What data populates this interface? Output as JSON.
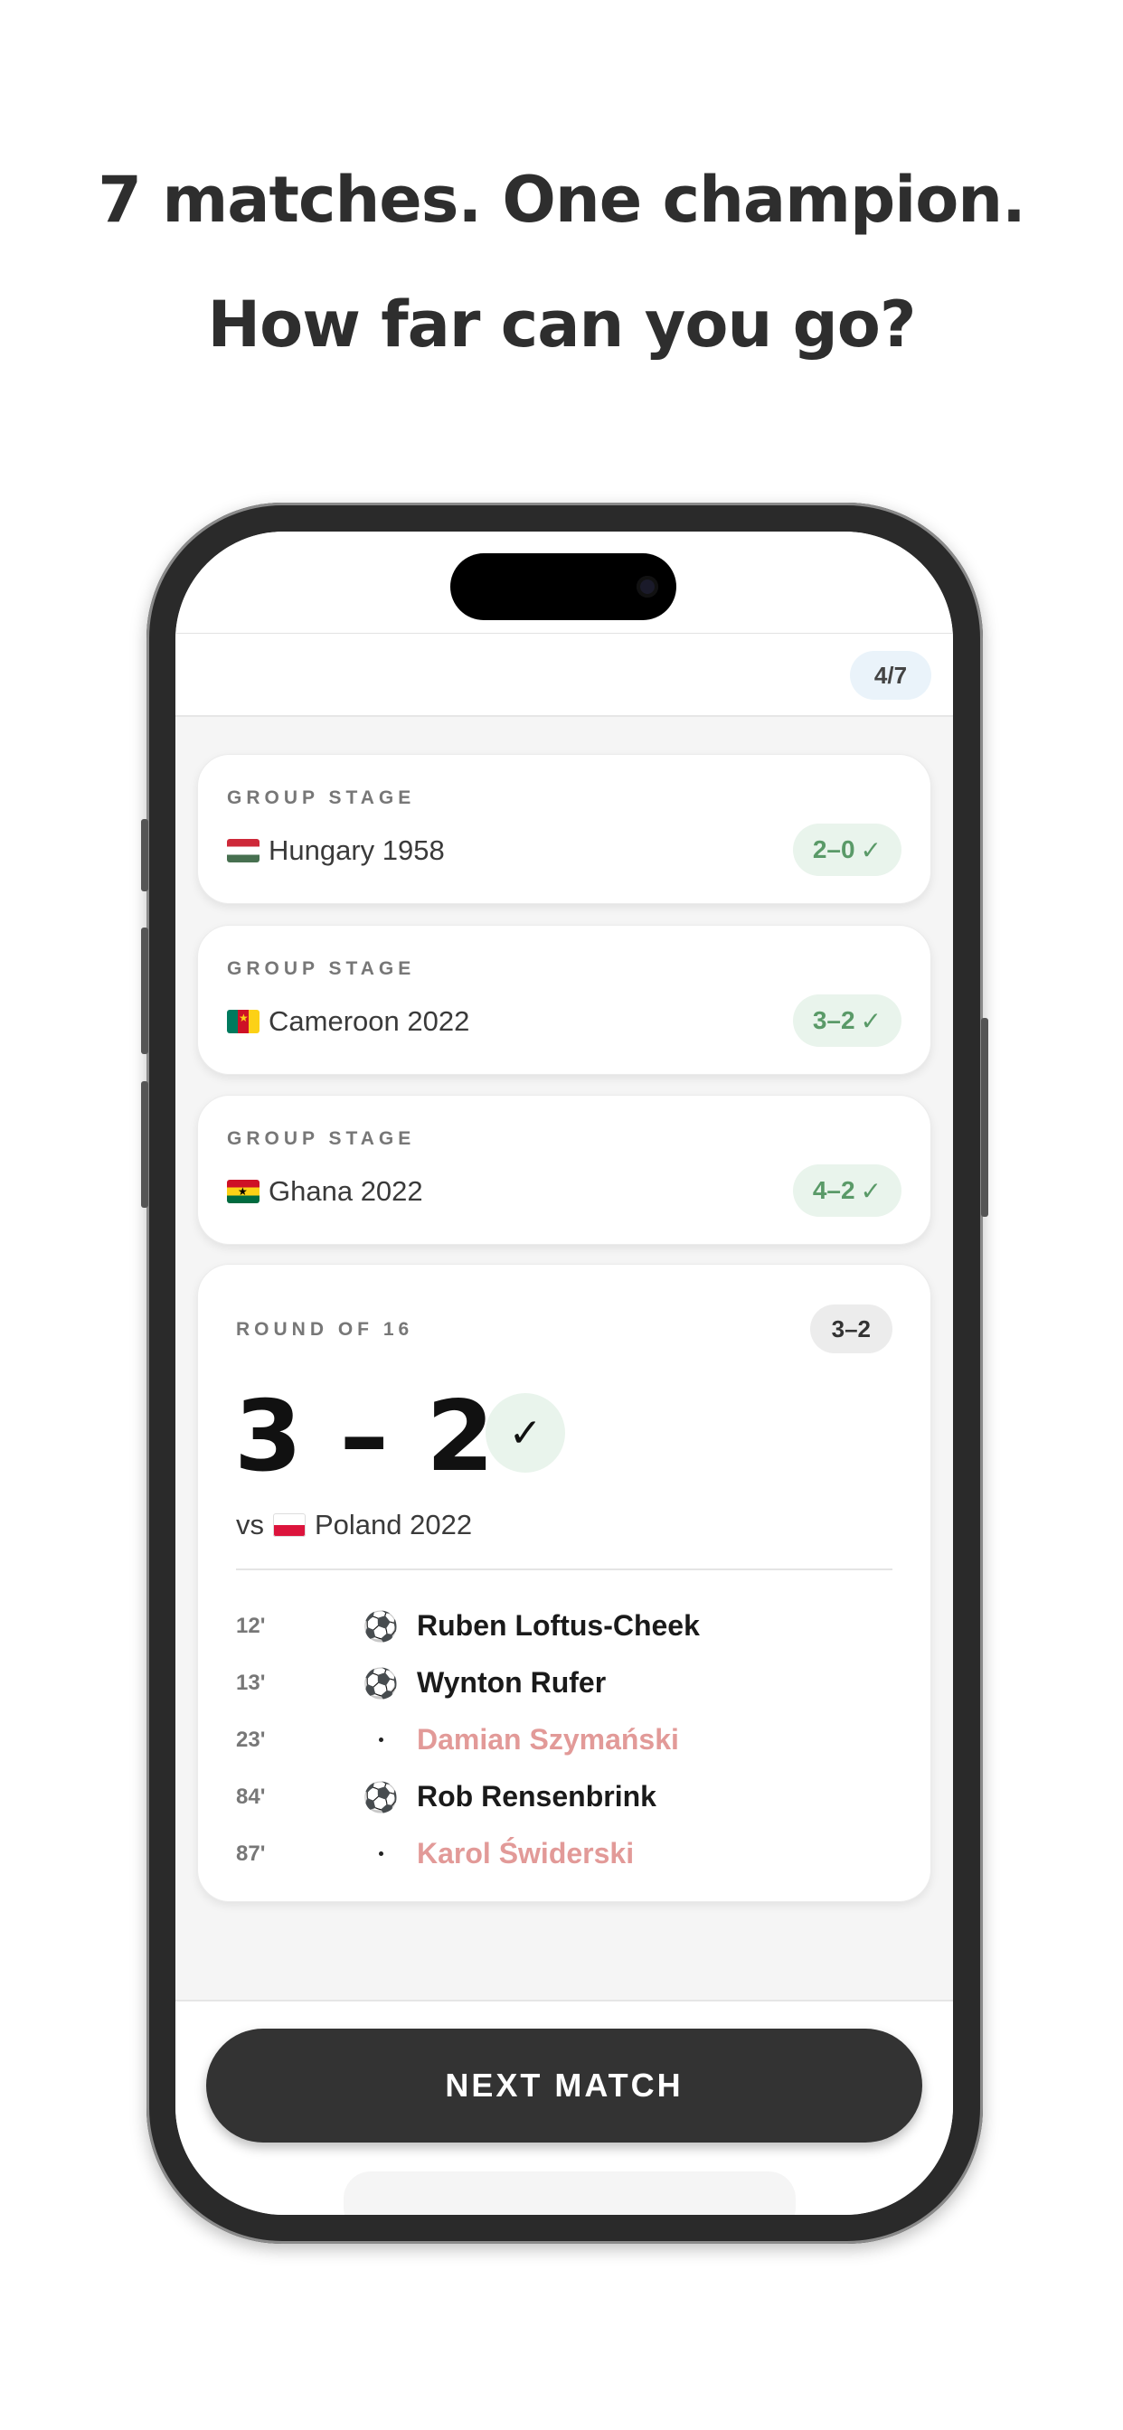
{
  "marketing": {
    "headline_1": "7 matches. One champion.",
    "headline_2": "How far can you go?"
  },
  "progress": {
    "label": "4/7",
    "current": 4,
    "total": 7
  },
  "previous_matches": [
    {
      "stage": "GROUP STAGE",
      "flag": "hungary-flag",
      "team": "Hungary 1958",
      "result": "2–0",
      "result_icon": "✓"
    },
    {
      "stage": "GROUP STAGE",
      "flag": "cameroon-flag",
      "team": "Cameroon 2022",
      "result": "3–2",
      "result_icon": "✓"
    },
    {
      "stage": "GROUP STAGE",
      "flag": "ghana-flag",
      "team": "Ghana 2022",
      "result": "4–2",
      "result_icon": "✓"
    }
  ],
  "current_match": {
    "stage": "ROUND OF 16",
    "score_badge": "3–2",
    "big_score": "3 – 2",
    "check": "✓",
    "vs_prefix": "vs",
    "opponent_flag": "poland-flag",
    "opponent": "Poland 2022",
    "events": [
      {
        "minute": "12'",
        "icon": "soccer-ball-icon",
        "glyph": "⚽",
        "player": "Ruben Loftus-Cheek",
        "side": "own"
      },
      {
        "minute": "13'",
        "icon": "soccer-ball-icon",
        "glyph": "⚽",
        "player": "Wynton Rufer",
        "side": "own"
      },
      {
        "minute": "23'",
        "icon": "dot-icon",
        "glyph": "",
        "player": "Damian Szymański",
        "side": "opponent"
      },
      {
        "minute": "84'",
        "icon": "soccer-ball-icon",
        "glyph": "⚽",
        "player": "Rob Rensenbrink",
        "side": "own"
      },
      {
        "minute": "87'",
        "icon": "dot-icon",
        "glyph": "",
        "player": "Karol Świderski",
        "side": "opponent"
      }
    ]
  },
  "next_button": {
    "label": "NEXT MATCH"
  },
  "colors": {
    "win_bg": "#e9f4ec",
    "win_text": "#5a9a68",
    "opponent_scorer": "#e29a98",
    "button_bg": "#333333",
    "progress_pill_bg": "#eaf3fa"
  }
}
